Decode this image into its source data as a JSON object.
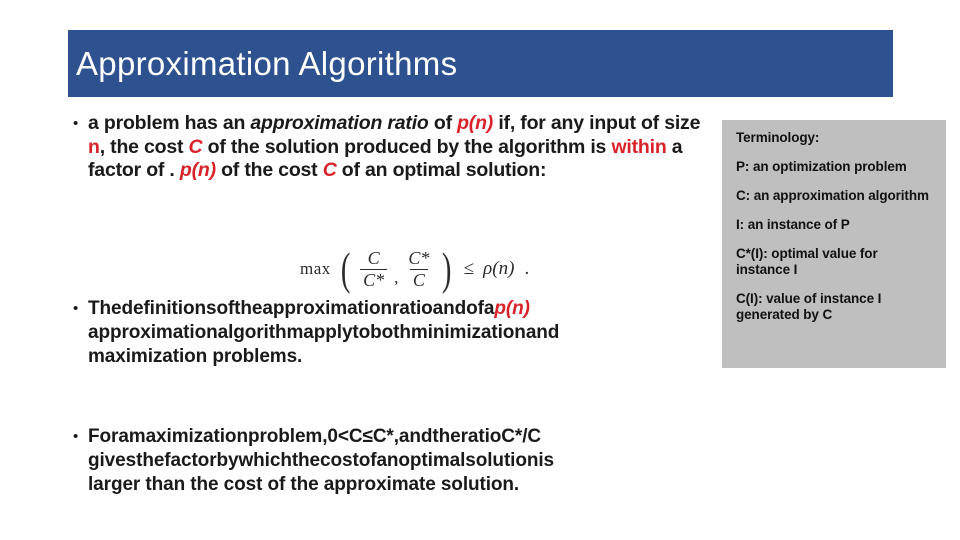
{
  "slide": {
    "title": "Approximation Algorithms",
    "header_color": "#2e5190",
    "accent_red": "#d8232a",
    "panel_color": "#bfbfbf"
  },
  "bullets": {
    "marker": "•",
    "b1": {
      "l1_a": "a problem has an ",
      "l1_em": "approximation ratio",
      "l1_b": " of ",
      "l1_red": "p(n)",
      "l1_c": " if, for any input",
      "l2_a": "of size ",
      "l2_red": "n",
      "l2_b": ", the cost ",
      "l2_var": "C",
      "l2_c": " of the solution produced by the algorithm",
      "l3_a": "is ",
      "l3_red": "within",
      "l3_b": " a factor of . ",
      "l3_red2": "p(n)",
      "l3_c": " of the cost ",
      "l3_var": "C",
      "l3_d": " of an optimal solution:"
    },
    "b2": {
      "l1_w": [
        "The",
        "definitions",
        "of",
        "the",
        "approximation",
        "ratio",
        "and",
        "of",
        "a"
      ],
      "l1_red": "p(n)",
      "l2_w": [
        "approximation",
        "algorithm",
        "apply",
        "to",
        "both",
        "minimization",
        "and"
      ],
      "l3": "maximization problems."
    },
    "b3": {
      "l1_w": [
        "For",
        "a",
        "maximization",
        "problem,",
        "0",
        "<",
        "C",
        "≤",
        "C*,",
        "and",
        "the",
        "ratio",
        "C*/C"
      ],
      "l2_w": [
        "gives",
        "the",
        "factor",
        "by",
        "which",
        "the",
        "cost",
        "of",
        "an",
        "optimal",
        "solution",
        "is"
      ],
      "l3": "larger than the cost of the approximate solution."
    }
  },
  "formula": {
    "op": "max",
    "lparen": "(",
    "frac1_num": "C",
    "frac1_den": "C*",
    "comma": ",",
    "frac2_num": "C*",
    "frac2_den": "C",
    "rparen": ")",
    "relation": "≤",
    "rho": "ρ(n)",
    "period": "."
  },
  "terminology": {
    "heading": "Terminology:",
    "items": [
      "P: an optimization problem",
      "C: an approximation algorithm",
      "I: an instance of P",
      "C*(I): optimal value for instance I",
      "C(I): value of instance I generated by C"
    ]
  }
}
